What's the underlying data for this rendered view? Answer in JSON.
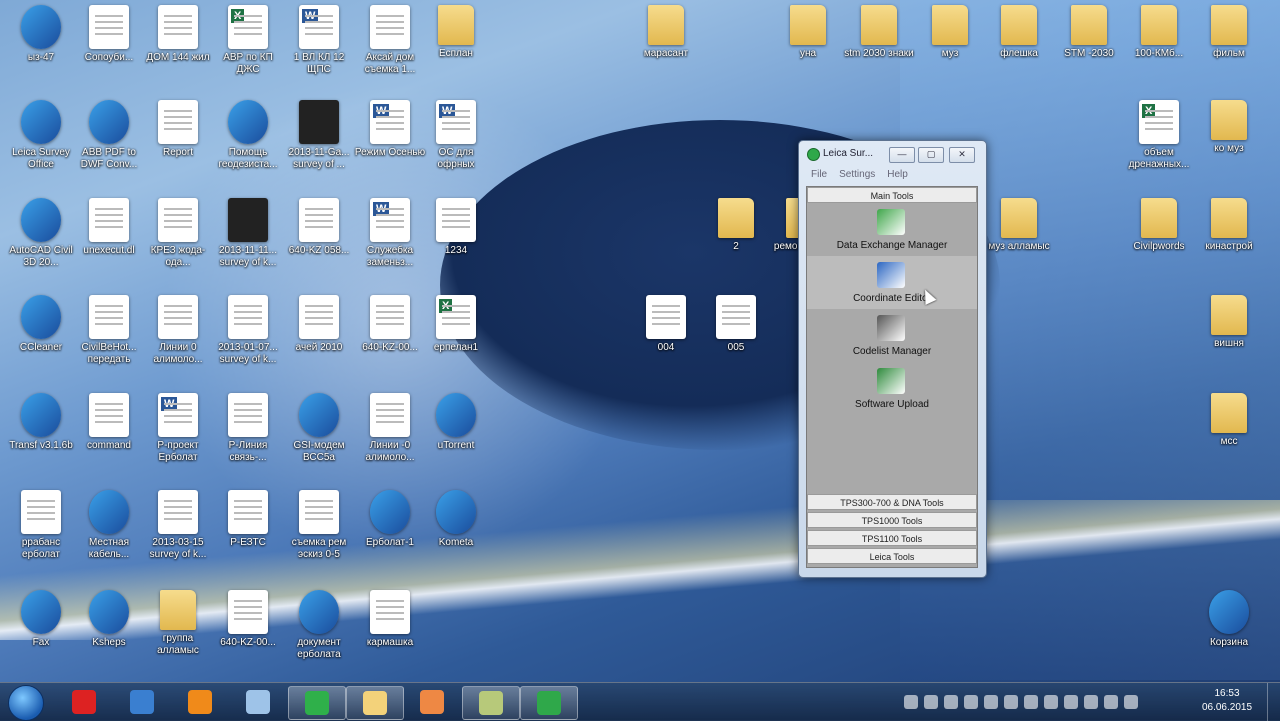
{
  "desktop": {
    "icons": [
      {
        "label": "ыз-47",
        "kind": "monitor"
      },
      {
        "label": "Сопоуби...",
        "kind": "doc"
      },
      {
        "label": "ДОМ 144 жил",
        "kind": "doc"
      },
      {
        "label": "АВР по КП ДЖС",
        "kind": "excel"
      },
      {
        "label": "1 ВЛ КЛ 12 ЩПС",
        "kind": "word"
      },
      {
        "label": "Аксай дом съемка 1...",
        "kind": "doc"
      },
      {
        "label": "Есплан",
        "kind": "folder"
      },
      {
        "label": "марасант",
        "kind": "folder"
      },
      {
        "label": "уна",
        "kind": "folder"
      },
      {
        "label": "stm 2030 знаки",
        "kind": "folder"
      },
      {
        "label": "муз",
        "kind": "folder"
      },
      {
        "label": "флешка",
        "kind": "folder"
      },
      {
        "label": "STM -2030",
        "kind": "folder"
      },
      {
        "label": "100-КМб...",
        "kind": "folder"
      },
      {
        "label": "фильм",
        "kind": "folder"
      },
      {
        "label": "Leica Survey Office",
        "kind": "app"
      },
      {
        "label": "ABB PDF to DWF Conv...",
        "kind": "app"
      },
      {
        "label": "Report",
        "kind": "doc"
      },
      {
        "label": "Помощь геодезиста...",
        "kind": "app"
      },
      {
        "label": "2013-11-Ga... survey of ...",
        "kind": "dark"
      },
      {
        "label": "Режим Осенью",
        "kind": "word"
      },
      {
        "label": "ОС для офрных",
        "kind": "word"
      },
      {
        "label": "объем дренажных...",
        "kind": "excel"
      },
      {
        "label": "ко муз",
        "kind": "folder"
      },
      {
        "label": "AutoCAD Civil 3D 20...",
        "kind": "app"
      },
      {
        "label": "unexecut.dl",
        "kind": "doc"
      },
      {
        "label": "КРЕЗ жода-ода...",
        "kind": "doc"
      },
      {
        "label": "2013-11-11... survey of k...",
        "kind": "dark"
      },
      {
        "label": "640-KZ 058...",
        "kind": "doc"
      },
      {
        "label": "Служебка заменьз...",
        "kind": "word"
      },
      {
        "label": "1234",
        "kind": "doc"
      },
      {
        "label": "2",
        "kind": "folder"
      },
      {
        "label": "ремонт съем",
        "kind": "folder"
      },
      {
        "label": "муз алламыс",
        "kind": "folder"
      },
      {
        "label": "Civilpwords",
        "kind": "folder"
      },
      {
        "label": "кинастрой",
        "kind": "folder"
      },
      {
        "label": "CCleaner",
        "kind": "app"
      },
      {
        "label": "CivilBeHot... передать",
        "kind": "doc"
      },
      {
        "label": "Линии 0 алимоло...",
        "kind": "doc"
      },
      {
        "label": "2013-01-07... survey of k...",
        "kind": "doc"
      },
      {
        "label": "ачей 2010",
        "kind": "doc"
      },
      {
        "label": "640-KZ-00...",
        "kind": "doc"
      },
      {
        "label": "ерпелан1",
        "kind": "excel"
      },
      {
        "label": "004",
        "kind": "doc"
      },
      {
        "label": "005",
        "kind": "doc"
      },
      {
        "label": "вишня",
        "kind": "folder"
      },
      {
        "label": "Transf v3.1.6b",
        "kind": "app"
      },
      {
        "label": "command",
        "kind": "doc"
      },
      {
        "label": "Р-проект Ерболат",
        "kind": "word"
      },
      {
        "label": "P-Линия связь-...",
        "kind": "doc"
      },
      {
        "label": "GSI-модем ВСС5а",
        "kind": "app"
      },
      {
        "label": "Линии -0 алимоло...",
        "kind": "doc"
      },
      {
        "label": "uTorrent",
        "kind": "app"
      },
      {
        "label": "мсс",
        "kind": "folder"
      },
      {
        "label": "ррабанс ерболат",
        "kind": "doc"
      },
      {
        "label": "Местная кабель...",
        "kind": "app"
      },
      {
        "label": "2013-03-15 survey of k...",
        "kind": "doc"
      },
      {
        "label": "P-ЕЗТС",
        "kind": "doc"
      },
      {
        "label": "съемка рем эскиз 0-5",
        "kind": "doc"
      },
      {
        "label": "Ерболат-1",
        "kind": "app"
      },
      {
        "label": "Kometa",
        "kind": "app"
      },
      {
        "label": "Fax",
        "kind": "app"
      },
      {
        "label": "Ksheps",
        "kind": "app"
      },
      {
        "label": "группа алламыс",
        "kind": "folder"
      },
      {
        "label": "640-KZ-00...",
        "kind": "doc"
      },
      {
        "label": "документ ерболата",
        "kind": "app"
      },
      {
        "label": "кармашка",
        "kind": "doc"
      },
      {
        "label": "Корзина",
        "kind": "app"
      }
    ]
  },
  "window": {
    "title": "Leica Sur...",
    "min_label": "—",
    "max_label": "▢",
    "close_label": "✕",
    "menu": [
      "File",
      "Settings",
      "Help"
    ],
    "main_section": "Main Tools",
    "tools": [
      {
        "label": "Data Exchange Manager",
        "icon": "data-exchange-icon",
        "color": "#3fa64a"
      },
      {
        "label": "Coordinate Editor",
        "icon": "coordinate-editor-icon",
        "color": "#2b66c2"
      },
      {
        "label": "Codelist Manager",
        "icon": "codelist-icon",
        "color": "#555555"
      },
      {
        "label": "Software Upload",
        "icon": "software-upload-icon",
        "color": "#2e8a3c"
      }
    ],
    "bottom_sections": [
      "TPS300-700 & DNA Tools",
      "TPS1000 Tools",
      "TPS1100 Tools",
      "Leica Tools"
    ]
  },
  "taskbar": {
    "apps": [
      {
        "name": "yandex-browser-icon",
        "color": "#d22"
      },
      {
        "name": "ie-icon",
        "color": "#3a7fd0"
      },
      {
        "name": "media-player-icon",
        "color": "#f08a1a"
      },
      {
        "name": "notepad-icon",
        "color": "#9ec3e8"
      },
      {
        "name": "mail-agent-icon",
        "color": "#2fb04a",
        "open": true
      },
      {
        "name": "explorer-icon",
        "color": "#f3d27a",
        "open": true
      },
      {
        "name": "kometa-icon",
        "color": "#e84"
      },
      {
        "name": "notes-icon",
        "color": "#b7c97a",
        "open": true
      },
      {
        "name": "leica-survey-office-icon",
        "color": "#2fa84a",
        "open": true
      }
    ],
    "clock_time": "16:53",
    "clock_date": "06.06.2015"
  }
}
